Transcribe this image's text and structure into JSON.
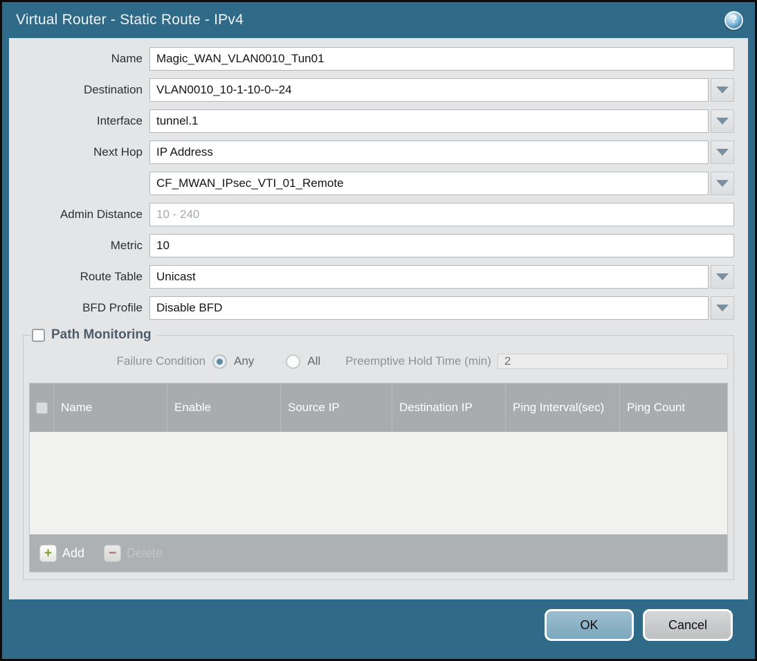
{
  "dialog": {
    "title": "Virtual Router - Static Route - IPv4",
    "help_glyph": "?"
  },
  "form": {
    "name": {
      "label": "Name",
      "value": "Magic_WAN_VLAN0010_Tun01"
    },
    "destination": {
      "label": "Destination",
      "value": "VLAN0010_10-1-10-0--24"
    },
    "interface": {
      "label": "Interface",
      "value": "tunnel.1"
    },
    "next_hop": {
      "label": "Next Hop",
      "value": "IP Address"
    },
    "next_hop_address": {
      "value": "CF_MWAN_IPsec_VTI_01_Remote"
    },
    "admin_distance": {
      "label": "Admin Distance",
      "placeholder": "10 - 240",
      "value": ""
    },
    "metric": {
      "label": "Metric",
      "value": "10"
    },
    "route_table": {
      "label": "Route Table",
      "value": "Unicast"
    },
    "bfd_profile": {
      "label": "BFD Profile",
      "value": "Disable BFD"
    }
  },
  "path_monitoring": {
    "title": "Path Monitoring",
    "enabled": false,
    "failure_condition": {
      "label": "Failure Condition",
      "options": [
        "Any",
        "All"
      ],
      "selected": "Any"
    },
    "preemptive_hold_time": {
      "label": "Preemptive Hold Time (min)",
      "value": "2"
    },
    "table": {
      "columns": [
        "Name",
        "Enable",
        "Source IP",
        "Destination IP",
        "Ping Interval(sec)",
        "Ping Count"
      ],
      "rows": []
    },
    "add_label": "Add",
    "delete_label": "Delete"
  },
  "footer": {
    "ok_label": "OK",
    "cancel_label": "Cancel"
  },
  "colors": {
    "titlebar_teal": "#2f6b89",
    "content_bg": "#e4e5e6",
    "table_header_gray": "#a9acae",
    "ok_button_blue": "#85aec3",
    "add_plus_green": "#7ca02c",
    "delete_minus_red": "#a25a50"
  }
}
